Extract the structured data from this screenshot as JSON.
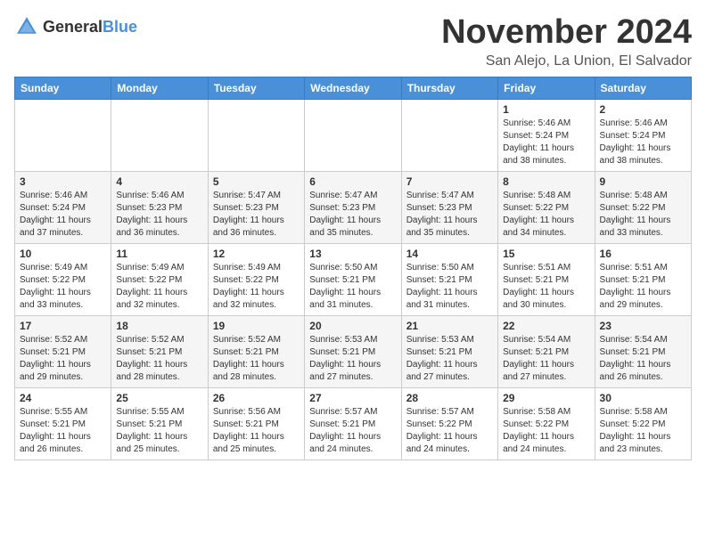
{
  "header": {
    "logo": {
      "general": "General",
      "blue": "Blue"
    },
    "title": "November 2024",
    "location": "San Alejo, La Union, El Salvador"
  },
  "weekdays": [
    "Sunday",
    "Monday",
    "Tuesday",
    "Wednesday",
    "Thursday",
    "Friday",
    "Saturday"
  ],
  "weeks": [
    [
      {
        "day": "",
        "info": ""
      },
      {
        "day": "",
        "info": ""
      },
      {
        "day": "",
        "info": ""
      },
      {
        "day": "",
        "info": ""
      },
      {
        "day": "",
        "info": ""
      },
      {
        "day": "1",
        "info": "Sunrise: 5:46 AM\nSunset: 5:24 PM\nDaylight: 11 hours\nand 38 minutes."
      },
      {
        "day": "2",
        "info": "Sunrise: 5:46 AM\nSunset: 5:24 PM\nDaylight: 11 hours\nand 38 minutes."
      }
    ],
    [
      {
        "day": "3",
        "info": "Sunrise: 5:46 AM\nSunset: 5:24 PM\nDaylight: 11 hours\nand 37 minutes."
      },
      {
        "day": "4",
        "info": "Sunrise: 5:46 AM\nSunset: 5:23 PM\nDaylight: 11 hours\nand 36 minutes."
      },
      {
        "day": "5",
        "info": "Sunrise: 5:47 AM\nSunset: 5:23 PM\nDaylight: 11 hours\nand 36 minutes."
      },
      {
        "day": "6",
        "info": "Sunrise: 5:47 AM\nSunset: 5:23 PM\nDaylight: 11 hours\nand 35 minutes."
      },
      {
        "day": "7",
        "info": "Sunrise: 5:47 AM\nSunset: 5:23 PM\nDaylight: 11 hours\nand 35 minutes."
      },
      {
        "day": "8",
        "info": "Sunrise: 5:48 AM\nSunset: 5:22 PM\nDaylight: 11 hours\nand 34 minutes."
      },
      {
        "day": "9",
        "info": "Sunrise: 5:48 AM\nSunset: 5:22 PM\nDaylight: 11 hours\nand 33 minutes."
      }
    ],
    [
      {
        "day": "10",
        "info": "Sunrise: 5:49 AM\nSunset: 5:22 PM\nDaylight: 11 hours\nand 33 minutes."
      },
      {
        "day": "11",
        "info": "Sunrise: 5:49 AM\nSunset: 5:22 PM\nDaylight: 11 hours\nand 32 minutes."
      },
      {
        "day": "12",
        "info": "Sunrise: 5:49 AM\nSunset: 5:22 PM\nDaylight: 11 hours\nand 32 minutes."
      },
      {
        "day": "13",
        "info": "Sunrise: 5:50 AM\nSunset: 5:21 PM\nDaylight: 11 hours\nand 31 minutes."
      },
      {
        "day": "14",
        "info": "Sunrise: 5:50 AM\nSunset: 5:21 PM\nDaylight: 11 hours\nand 31 minutes."
      },
      {
        "day": "15",
        "info": "Sunrise: 5:51 AM\nSunset: 5:21 PM\nDaylight: 11 hours\nand 30 minutes."
      },
      {
        "day": "16",
        "info": "Sunrise: 5:51 AM\nSunset: 5:21 PM\nDaylight: 11 hours\nand 29 minutes."
      }
    ],
    [
      {
        "day": "17",
        "info": "Sunrise: 5:52 AM\nSunset: 5:21 PM\nDaylight: 11 hours\nand 29 minutes."
      },
      {
        "day": "18",
        "info": "Sunrise: 5:52 AM\nSunset: 5:21 PM\nDaylight: 11 hours\nand 28 minutes."
      },
      {
        "day": "19",
        "info": "Sunrise: 5:52 AM\nSunset: 5:21 PM\nDaylight: 11 hours\nand 28 minutes."
      },
      {
        "day": "20",
        "info": "Sunrise: 5:53 AM\nSunset: 5:21 PM\nDaylight: 11 hours\nand 27 minutes."
      },
      {
        "day": "21",
        "info": "Sunrise: 5:53 AM\nSunset: 5:21 PM\nDaylight: 11 hours\nand 27 minutes."
      },
      {
        "day": "22",
        "info": "Sunrise: 5:54 AM\nSunset: 5:21 PM\nDaylight: 11 hours\nand 27 minutes."
      },
      {
        "day": "23",
        "info": "Sunrise: 5:54 AM\nSunset: 5:21 PM\nDaylight: 11 hours\nand 26 minutes."
      }
    ],
    [
      {
        "day": "24",
        "info": "Sunrise: 5:55 AM\nSunset: 5:21 PM\nDaylight: 11 hours\nand 26 minutes."
      },
      {
        "day": "25",
        "info": "Sunrise: 5:55 AM\nSunset: 5:21 PM\nDaylight: 11 hours\nand 25 minutes."
      },
      {
        "day": "26",
        "info": "Sunrise: 5:56 AM\nSunset: 5:21 PM\nDaylight: 11 hours\nand 25 minutes."
      },
      {
        "day": "27",
        "info": "Sunrise: 5:57 AM\nSunset: 5:21 PM\nDaylight: 11 hours\nand 24 minutes."
      },
      {
        "day": "28",
        "info": "Sunrise: 5:57 AM\nSunset: 5:22 PM\nDaylight: 11 hours\nand 24 minutes."
      },
      {
        "day": "29",
        "info": "Sunrise: 5:58 AM\nSunset: 5:22 PM\nDaylight: 11 hours\nand 24 minutes."
      },
      {
        "day": "30",
        "info": "Sunrise: 5:58 AM\nSunset: 5:22 PM\nDaylight: 11 hours\nand 23 minutes."
      }
    ]
  ]
}
